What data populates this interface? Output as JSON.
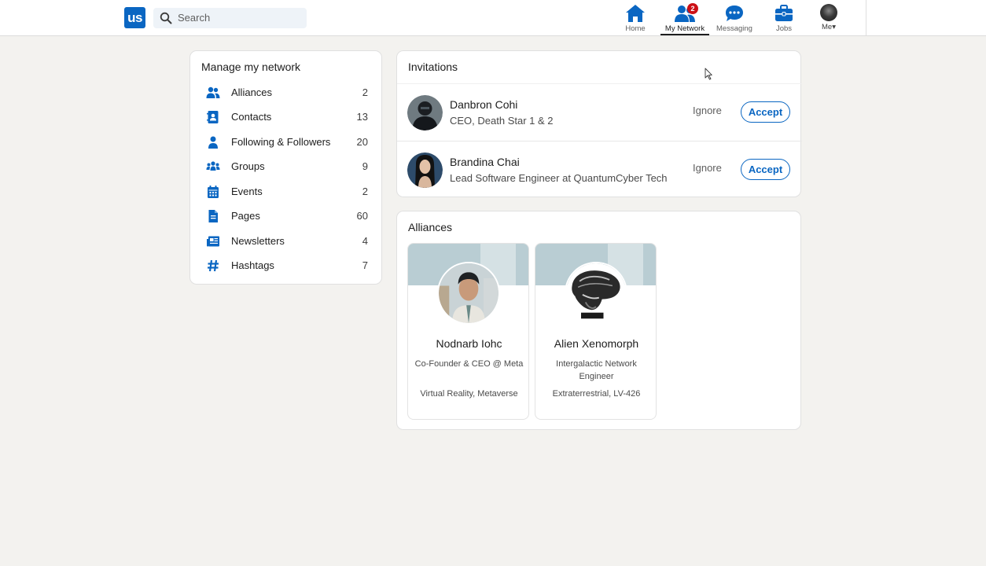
{
  "header": {
    "logo_text": "us",
    "search_placeholder": "Search",
    "nav": [
      {
        "label": "Home",
        "icon": "home-icon"
      },
      {
        "label": "My Network",
        "icon": "network-icon",
        "badge": "2"
      },
      {
        "label": "Messaging",
        "icon": "messaging-icon"
      },
      {
        "label": "Jobs",
        "icon": "briefcase-icon"
      },
      {
        "label": "Me▾",
        "icon": "avatar"
      }
    ]
  },
  "manage": {
    "title": "Manage my network",
    "items": [
      {
        "label": "Alliances",
        "count": "2",
        "icon": "people-icon"
      },
      {
        "label": "Contacts",
        "count": "13",
        "icon": "contact-card-icon"
      },
      {
        "label": "Following & Followers",
        "count": "20",
        "icon": "person-icon"
      },
      {
        "label": "Groups",
        "count": "9",
        "icon": "groups-icon"
      },
      {
        "label": "Events",
        "count": "2",
        "icon": "calendar-icon"
      },
      {
        "label": "Pages",
        "count": "60",
        "icon": "page-icon"
      },
      {
        "label": "Newsletters",
        "count": "4",
        "icon": "newspaper-icon"
      },
      {
        "label": "Hashtags",
        "count": "7",
        "icon": "hashtag-icon"
      }
    ]
  },
  "invitations": {
    "title": "Invitations",
    "ignore_label": "Ignore",
    "accept_label": "Accept",
    "items": [
      {
        "name": "Danbron Cohi",
        "title": "CEO, Death Star 1 & 2"
      },
      {
        "name": "Brandina Chai",
        "title": "Lead Software Engineer at QuantumCyber Tech"
      }
    ]
  },
  "alliances": {
    "title": "Alliances",
    "items": [
      {
        "name": "Nodnarb Iohc",
        "title": "Co-Founder & CEO @ Meta",
        "location": "Virtual Reality, Metaverse"
      },
      {
        "name": "Alien Xenomorph",
        "title": "Intergalactic Network Engineer",
        "location": "Extraterrestrial, LV-426"
      }
    ]
  },
  "colors": {
    "brand": "#0a66c2",
    "badge": "#cc1016",
    "background": "#f3f2ef"
  }
}
